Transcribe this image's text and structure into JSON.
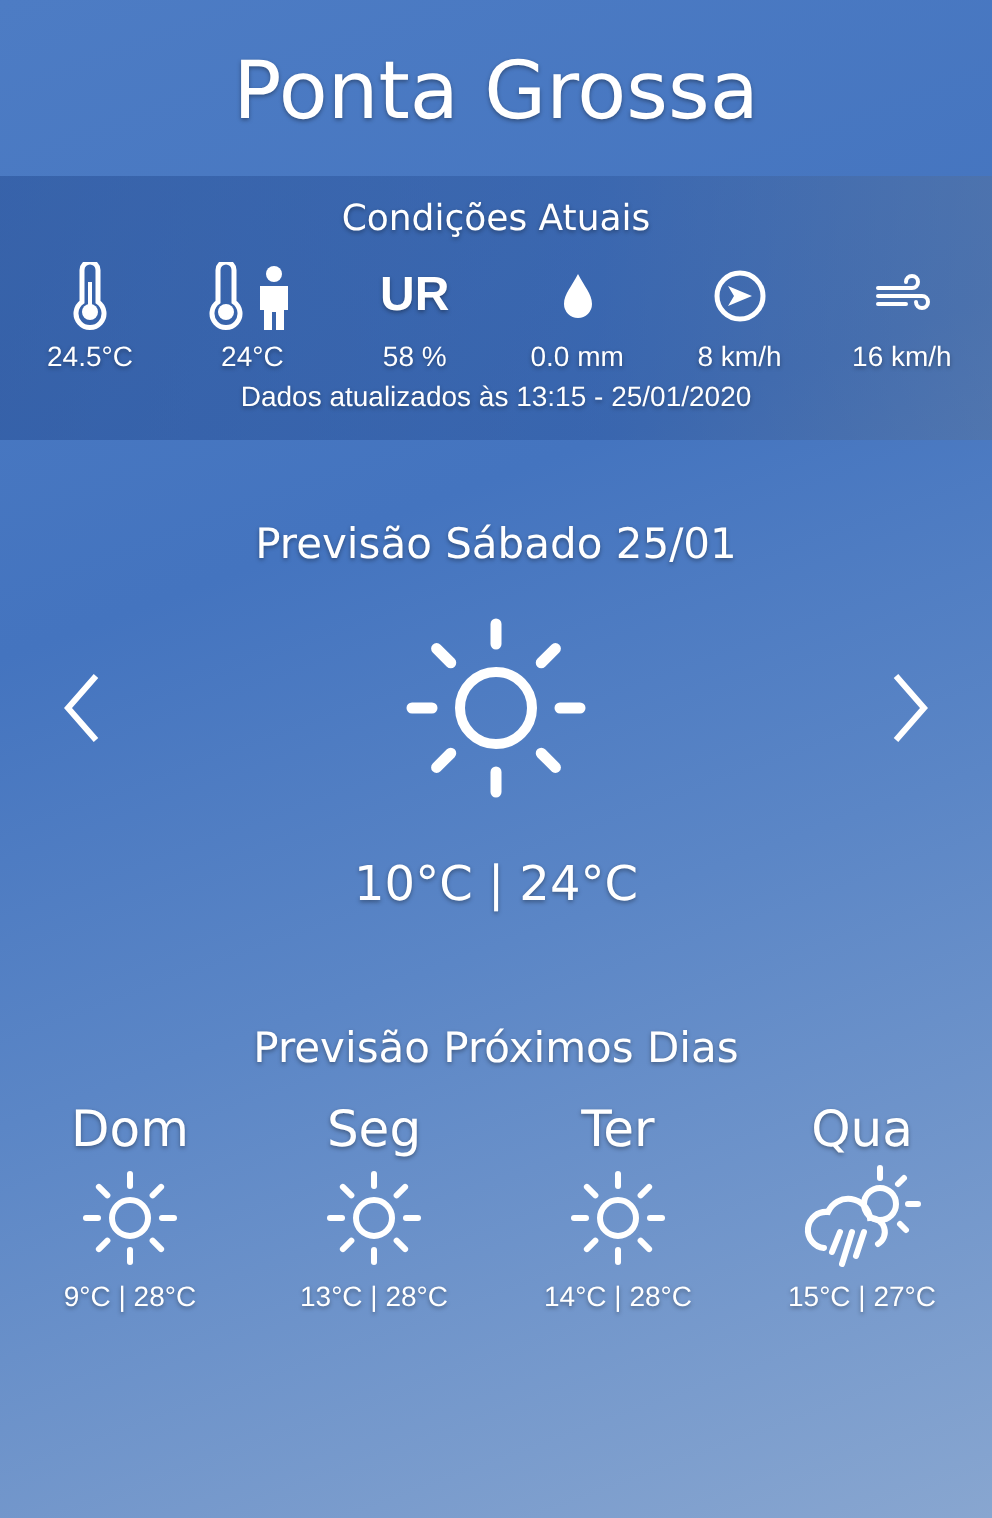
{
  "city": "Ponta Grossa",
  "current": {
    "title": "Condições Atuais",
    "items": [
      {
        "kind": "thermometer",
        "value": "24.5°C"
      },
      {
        "kind": "feels-like",
        "value": "24°C"
      },
      {
        "kind": "humidity",
        "label": "UR",
        "value": "58 %"
      },
      {
        "kind": "rain",
        "value": "0.0 mm"
      },
      {
        "kind": "wind-direction",
        "value": "8 km/h"
      },
      {
        "kind": "wind",
        "value": "16 km/h"
      }
    ],
    "updated": "Dados atualizados às 13:15 - 25/01/2020"
  },
  "today": {
    "title": "Previsão Sábado 25/01",
    "kind": "sun",
    "temps": "10°C | 24°C"
  },
  "next": {
    "title": "Previsão Próximos Dias",
    "days": [
      {
        "day": "Dom",
        "kind": "sun",
        "temps": "9°C | 28°C"
      },
      {
        "day": "Seg",
        "kind": "sun",
        "temps": "13°C | 28°C"
      },
      {
        "day": "Ter",
        "kind": "sun",
        "temps": "14°C | 28°C"
      },
      {
        "day": "Qua",
        "kind": "rain-sun",
        "temps": "15°C | 27°C"
      }
    ]
  }
}
